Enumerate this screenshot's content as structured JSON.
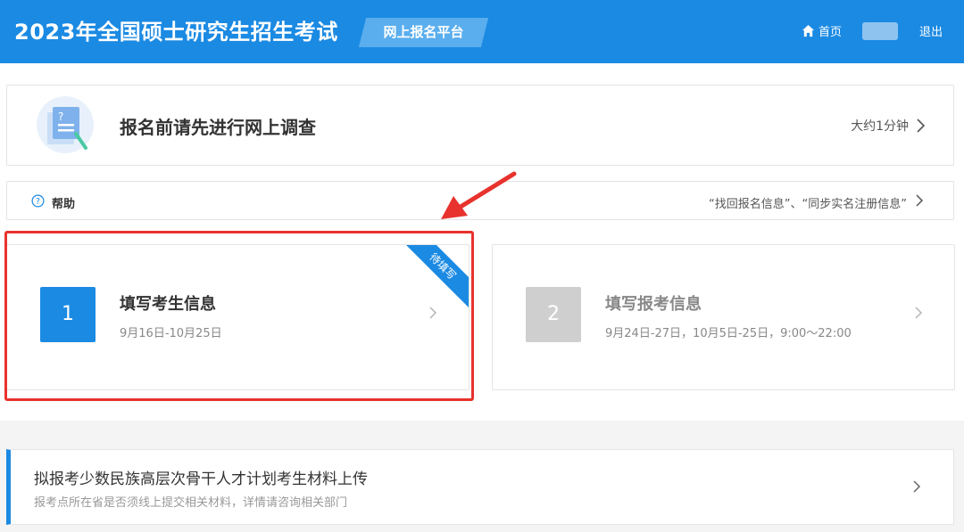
{
  "header": {
    "title": "2023年全国硕士研究生招生考试",
    "platform_tag": "网上报名平台",
    "home_label": "首页",
    "logout_label": "退出",
    "home_icon": "home-icon"
  },
  "survey": {
    "title": "报名前请先进行网上调查",
    "time_hint": "大约1分钟",
    "illustration": "questionnaire-illustration"
  },
  "help": {
    "label": "帮助",
    "links": "“找回报名信息”、“同步实名注册信息”",
    "icon": "question-circle-icon"
  },
  "steps": [
    {
      "number": "1",
      "title": "填写考生信息",
      "dates": "9月16日-10月25日",
      "badge": "待填写",
      "status": "active"
    },
    {
      "number": "2",
      "title": "填写报考信息",
      "dates": "9月24日-27日，10月5日-25日，9:00～22:00",
      "status": "inactive"
    }
  ],
  "upload": {
    "title": "拟报考少数民族高层次骨干人才计划考生材料上传",
    "subtitle": "报考点所在省是否须线上提交相关材料，详情请咨询相关部门"
  },
  "colors": {
    "brand": "#1b8ae3",
    "highlight": "#e8322d",
    "inactive": "#cfcfcf"
  }
}
